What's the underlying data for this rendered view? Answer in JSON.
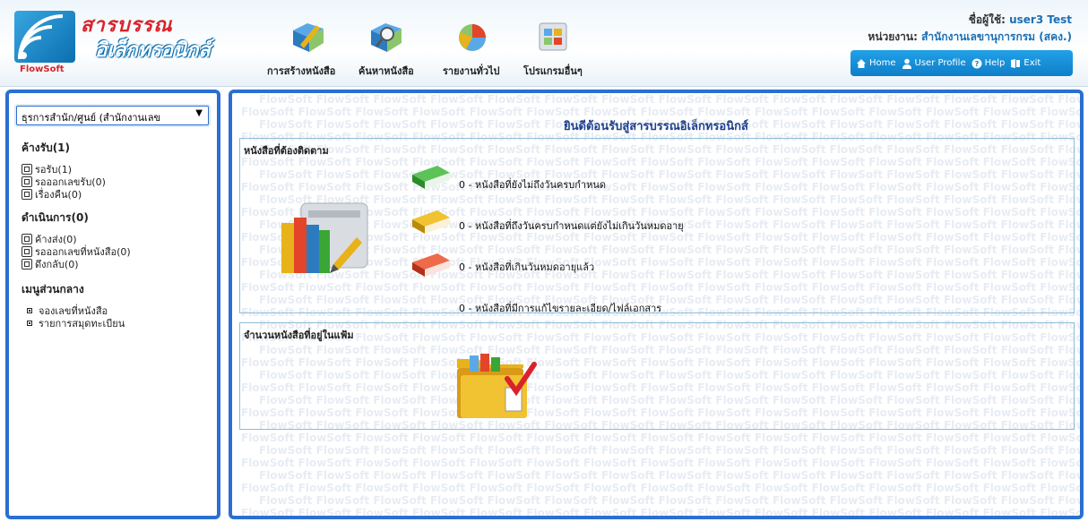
{
  "logo": {
    "line1": "สารบรรณ",
    "line2": "อิเล็กทรอนิกส์",
    "brand": "FlowSoft"
  },
  "menu": [
    {
      "label": "การสร้างหนังสือ",
      "icon": "create-document-icon"
    },
    {
      "label": "ค้นหาหนังสือ",
      "icon": "search-document-icon"
    },
    {
      "label": "รายงานทั่วไป",
      "icon": "pie-chart-icon"
    },
    {
      "label": "โปรแกรมอื่นๆ",
      "icon": "apps-grid-icon"
    }
  ],
  "user": {
    "name_label": "ชื่อผู้ใช้:",
    "name": "user3 Test",
    "unit_label": "หน่วยงาน:",
    "unit": "สำนักงานเลขานุการกรม (สคง.)"
  },
  "toolbar": {
    "home": "Home",
    "profile": "User Profile",
    "help": "Help",
    "exit": "Exit"
  },
  "sidebar": {
    "select_value": "ธุรการสำนัก/ศูนย์ (สำนักงานเลข",
    "sections": [
      {
        "title": "ค้างรับ(1)",
        "items": [
          "รอรับ(1)",
          "รอออกเลขรับ(0)",
          "เรื่องคืน(0)"
        ]
      },
      {
        "title": "ดำเนินการ(0)",
        "items": [
          "ค้างส่ง(0)",
          "รอออกเลขที่หนังสือ(0)",
          "ดึงกลับ(0)"
        ]
      },
      {
        "title": "เมนูส่วนกลาง",
        "items": [
          "จองเลขที่หนังสือ",
          "รายการสมุดทะเบียน"
        ]
      }
    ]
  },
  "main": {
    "welcome": "ยินดีต้อนรับสู่สารบรรณอิเล็กทรอนิกส์",
    "watermark": "FlowSoft",
    "followup_title": "หนังสือที่ต้องติดตาม",
    "stats": [
      {
        "text": "0 - หนังสือที่ยังไม่ถึงวันครบกำหนด",
        "color": "#3aa635"
      },
      {
        "text": "0 - หนังสือที่ถึงวันครบกำหนดแต่ยังไม่เกินวันหมดอายุ",
        "color": "#e8b21a"
      },
      {
        "text": "0 - หนังสือที่เกินวันหมดอายุแล้ว",
        "color": "#e2452a"
      },
      {
        "text": "0 - หนังสือที่มีการแก้ไขรายละเอียด/ไฟล์เอกสาร",
        "color": ""
      }
    ],
    "folder_title": "จำนวนหนังสือที่อยู่ในแฟ้ม"
  }
}
